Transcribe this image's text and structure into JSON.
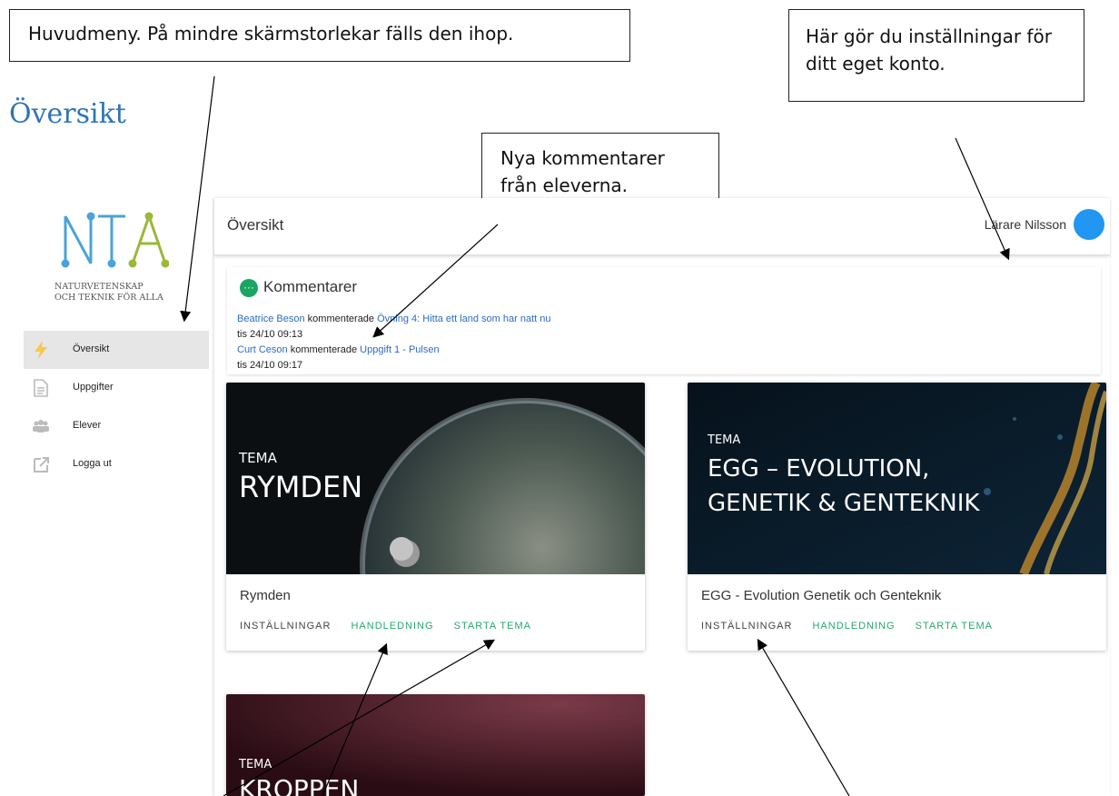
{
  "annotations": {
    "main_menu": "Huvudmeny. På mindre skärmstorlekar fälls den ihop.",
    "account": "Här gör du inställningar för ditt eget konto.",
    "comments": "Nya kommentarer från eleverna."
  },
  "doc_title": "Översikt",
  "logo": {
    "letters": "NTA",
    "line1": "NATURVETENSKAP",
    "line2": "OCH TEKNIK FÖR ALLA"
  },
  "topbar": {
    "title": "Översikt",
    "user_name": "Lärare Nilsson"
  },
  "sidebar": {
    "items": [
      {
        "label": "Översikt",
        "icon": "lightning-icon"
      },
      {
        "label": "Uppgifter",
        "icon": "document-icon"
      },
      {
        "label": "Elever",
        "icon": "users-icon"
      },
      {
        "label": "Logga ut",
        "icon": "external-link-icon"
      }
    ]
  },
  "comments": {
    "heading": "Kommentarer",
    "entries": [
      {
        "student": "Beatrice Beson",
        "verb": "kommenterade",
        "task": "Övning 4: Hitta ett land som har natt nu",
        "time": "tis 24/10 09:13"
      },
      {
        "student": "Curt Ceson",
        "verb": "kommenterade",
        "task": "Uppgift 1 - Pulsen",
        "time": "tis 24/10 09:17"
      }
    ]
  },
  "cards": [
    {
      "tema": "TEMA",
      "banner": "RYMDEN",
      "name": "Rymden",
      "settings": "INSTÄLLNINGAR",
      "guide": "HANDLEDNING",
      "start": "STARTA TEMA"
    },
    {
      "tema": "TEMA",
      "banner_line1": "EGG – EVOLUTION,",
      "banner_line2": "GENETIK & GENTEKNIK",
      "name": "EGG - Evolution Genetik och Genteknik",
      "settings": "INSTÄLLNINGAR",
      "guide": "HANDLEDNING",
      "start": "STARTA TEMA"
    },
    {
      "tema": "TEMA",
      "banner": "KROPPEN"
    }
  ],
  "colors": {
    "accent_green": "#26a96a",
    "link_blue": "#2b6cc4",
    "avatar_blue": "#2196f3",
    "logo_blue": "#4aa3d8",
    "logo_green": "#9ab83a"
  }
}
